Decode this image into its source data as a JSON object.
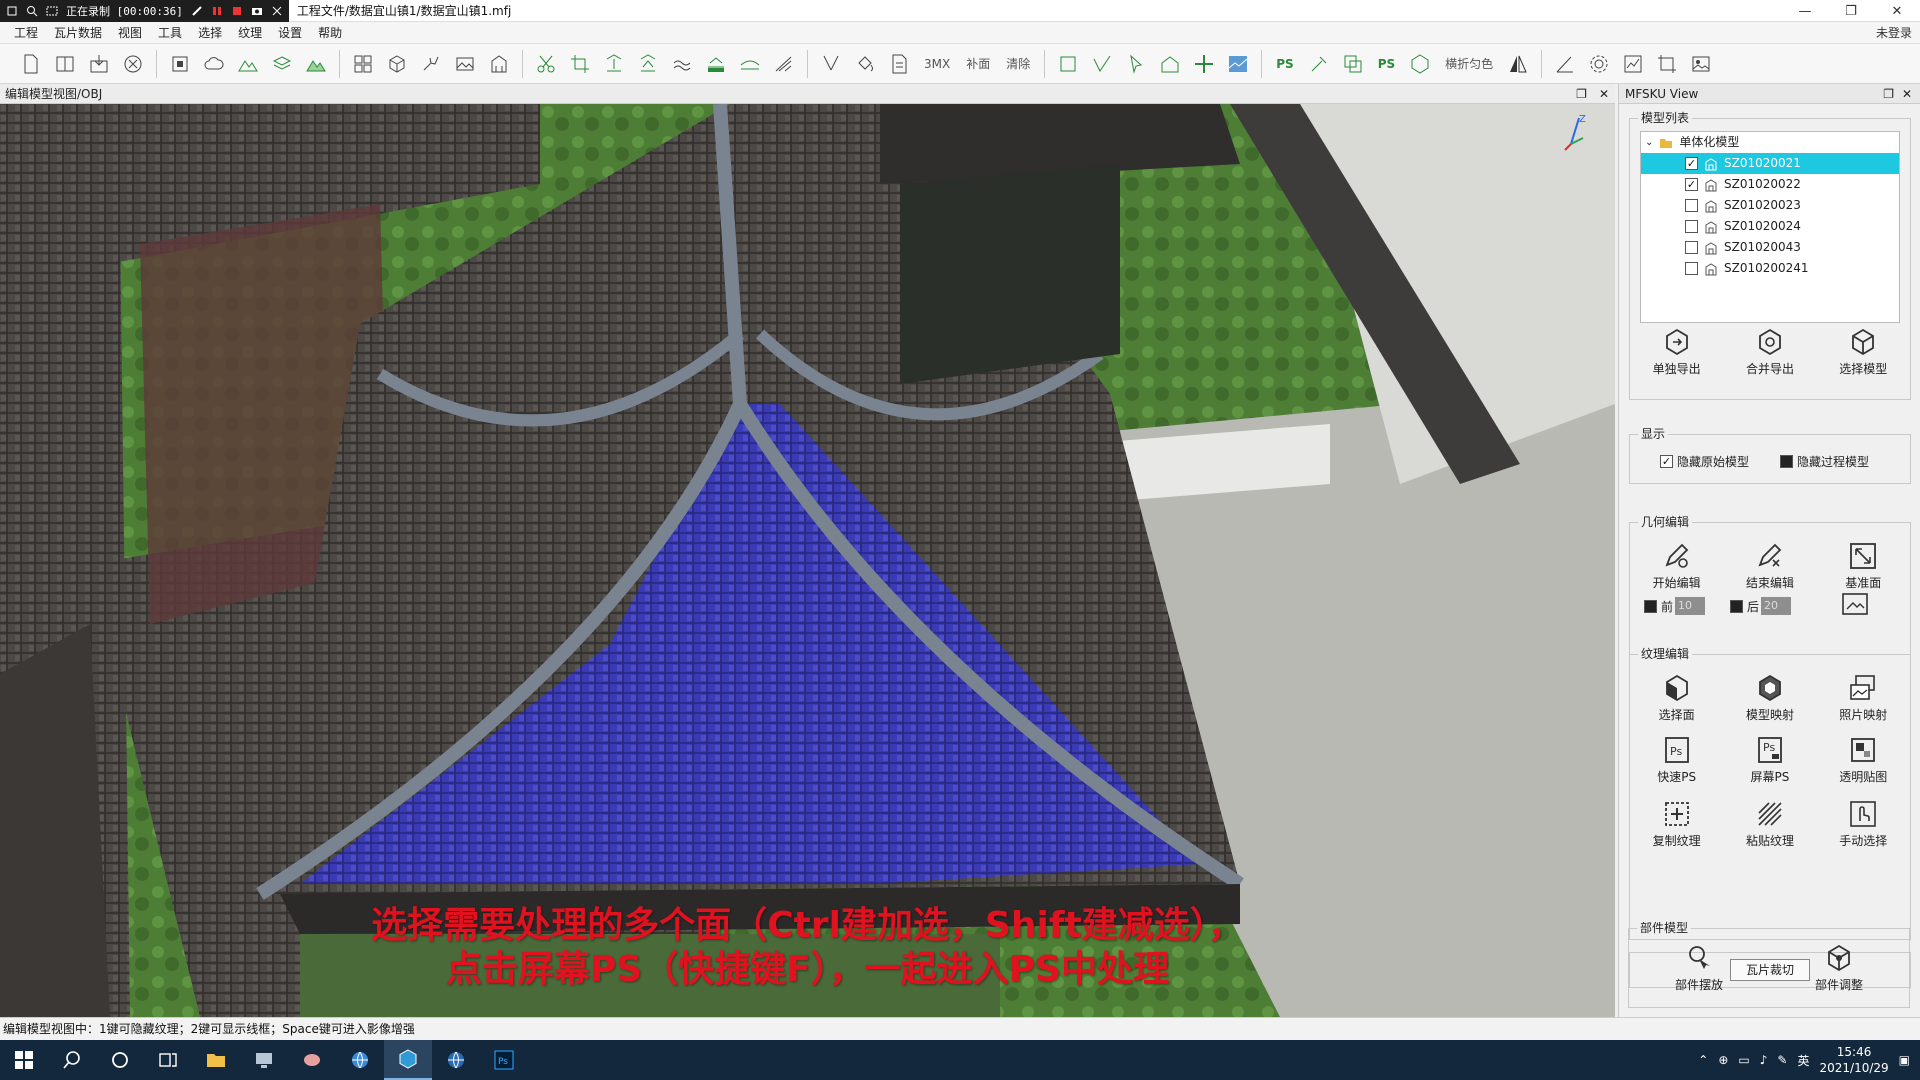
{
  "titlebar": {
    "recording_label": "正在录制",
    "recording_time": "[00:00:36]",
    "title": "工程文件/数据宜山镇1/数据宜山镇1.mfj",
    "minimize": "—",
    "maximize": "❐",
    "close": "✕"
  },
  "menu": {
    "items": [
      "工程",
      "瓦片数据",
      "视图",
      "工具",
      "选择",
      "纹理",
      "设置",
      "帮助"
    ],
    "login": "未登录"
  },
  "toolbar": {
    "text_3mx": "3MX",
    "text_bumian": "补面",
    "text_qingchu": "清除",
    "text_ps1": "PS",
    "text_ps2": "PS",
    "text_yunse": "横折匀色"
  },
  "viewport": {
    "title": "编辑模型视图/OBJ",
    "caption_line1": "选择需要处理的多个面（Ctrl建加选，Shift建减选），",
    "caption_line2": "点击屏幕PS（快捷键F），一起进入PS中处理",
    "axis_z": "Z",
    "colors": {
      "roof_tile": "#4a4744",
      "highlight": "#3b3ab0",
      "grass": "#5a8a3c",
      "wall": "#e8e8e6"
    }
  },
  "panel": {
    "title": "MFSKU View",
    "model_list_label": "模型列表",
    "tree_root": "单体化模型",
    "models": [
      {
        "name": "SZ01020021",
        "checked": true,
        "selected": true
      },
      {
        "name": "SZ01020022",
        "checked": true,
        "selected": false
      },
      {
        "name": "SZ01020023",
        "checked": false,
        "selected": false
      },
      {
        "name": "SZ01020024",
        "checked": false,
        "selected": false
      },
      {
        "name": "SZ01020043",
        "checked": false,
        "selected": false
      },
      {
        "name": "SZ010200241",
        "checked": false,
        "selected": false
      }
    ],
    "export_single": "单独导出",
    "export_merge": "合并导出",
    "select_model": "选择模型",
    "display_label": "显示",
    "hide_original": "隐藏原始模型",
    "hide_process": "隐藏过程模型",
    "geometry_label": "几何编辑",
    "start_edit": "开始编辑",
    "end_edit": "结束编辑",
    "base_plane": "基准面",
    "front_label": "前",
    "front_value": "10",
    "back_label": "后",
    "back_value": "20",
    "texture_label": "纹理编辑",
    "select_face": "选择面",
    "model_map": "模型映射",
    "photo_map": "照片映射",
    "quick_ps": "快速PS",
    "screen_ps": "屏幕PS",
    "transparent_map": "透明贴图",
    "copy_texture": "复制纹理",
    "paste_texture": "粘贴纹理",
    "manual_select": "手动选择",
    "tile_crop": "瓦片裁切",
    "component_label": "部件模型",
    "component_place": "部件摆放",
    "component_adjust": "部件调整"
  },
  "statusbar": {
    "text": "编辑模型视图中：1键可隐藏纹理；2键可显示线框；Space键可进入影像增强"
  },
  "taskbar": {
    "time": "15:46",
    "date": "2021/10/29",
    "ime": "英"
  }
}
